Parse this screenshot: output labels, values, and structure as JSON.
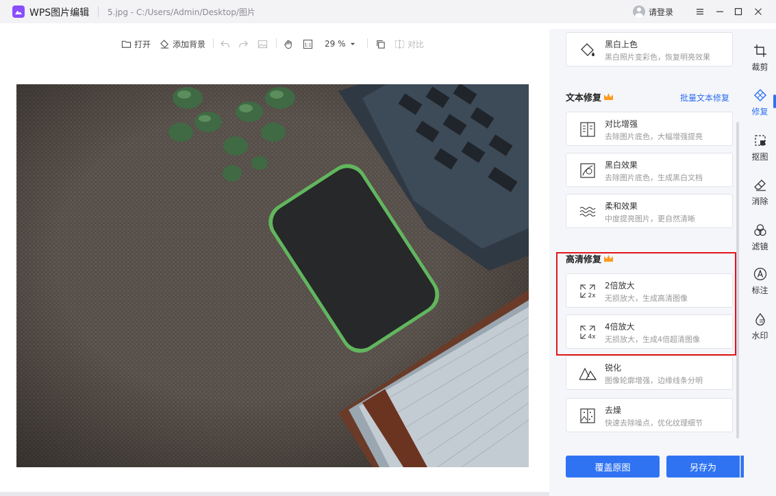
{
  "window": {
    "app_title": "WPS图片编辑",
    "file_path": "5.jpg - C:/Users/Admin/Desktop/图片",
    "login_label": "请登录"
  },
  "toolbar": {
    "open_label": "打开",
    "add_bg_label": "添加背景",
    "zoom_label": "29 %",
    "compare_label": "对比"
  },
  "panel": {
    "top_card": {
      "title": "黑白上色",
      "desc": "黑白照片变彩色，恢复明亮效果"
    },
    "text_repair": {
      "title": "文本修复",
      "batch_link": "批量文本修复",
      "items": [
        {
          "title": "对比增强",
          "desc": "去除图片底色，大幅增强提亮",
          "icon": "contrast-icon"
        },
        {
          "title": "黑白效果",
          "desc": "去除图片底色，生成黑白文档",
          "icon": "bw-doc-icon"
        },
        {
          "title": "柔和效果",
          "desc": "中度提亮图片，更自然清晰",
          "icon": "wave-icon"
        }
      ]
    },
    "hd_repair": {
      "title": "高清修复",
      "items": [
        {
          "title": "2倍放大",
          "desc": "无损放大，生成高清图像",
          "icon_text": "2x"
        },
        {
          "title": "4倍放大",
          "desc": "无损放大，生成4倍超清图像",
          "icon_text": "4x"
        },
        {
          "title": "锐化",
          "desc": "图像轮廓增强，边缘线条分明"
        },
        {
          "title": "去燥",
          "desc": "快速去除噪点，优化纹理细节"
        }
      ]
    },
    "overwrite_label": "覆盖原图",
    "save_as_label": "另存为"
  },
  "nav": {
    "items": [
      {
        "label": "裁剪",
        "icon": "crop-icon"
      },
      {
        "label": "修复",
        "icon": "repair-icon",
        "active": true
      },
      {
        "label": "抠图",
        "icon": "cutout-icon"
      },
      {
        "label": "消除",
        "icon": "eraser-icon"
      },
      {
        "label": "滤镜",
        "icon": "filter-icon"
      },
      {
        "label": "标注",
        "icon": "annotate-icon"
      },
      {
        "label": "水印",
        "icon": "watermark-icon"
      }
    ]
  },
  "colors": {
    "accent": "#2f73f2",
    "highlight_box": "#e0151b",
    "crown": "#ff9a1f"
  }
}
